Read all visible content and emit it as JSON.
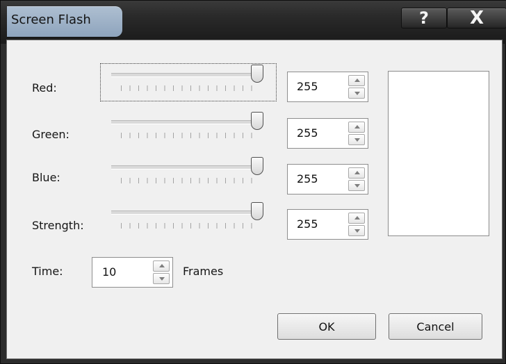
{
  "window": {
    "title": "Screen Flash",
    "help_symbol": "?",
    "close_symbol": "X"
  },
  "controls": {
    "red": {
      "label": "Red:",
      "value": "255"
    },
    "green": {
      "label": "Green:",
      "value": "255"
    },
    "blue": {
      "label": "Blue:",
      "value": "255"
    },
    "strength": {
      "label": "Strength:",
      "value": "255"
    }
  },
  "time": {
    "label": "Time:",
    "value": "10",
    "unit": "Frames"
  },
  "buttons": {
    "ok": "OK",
    "cancel": "Cancel"
  },
  "colors": {
    "title_tab": "#9eb2c8",
    "dialog_background": "#f0f0f0",
    "preview_color": "#ffffff"
  },
  "icons": {
    "help": "help-icon",
    "close": "close-icon",
    "spin_up": "chevron-up-icon",
    "spin_down": "chevron-down-icon"
  }
}
